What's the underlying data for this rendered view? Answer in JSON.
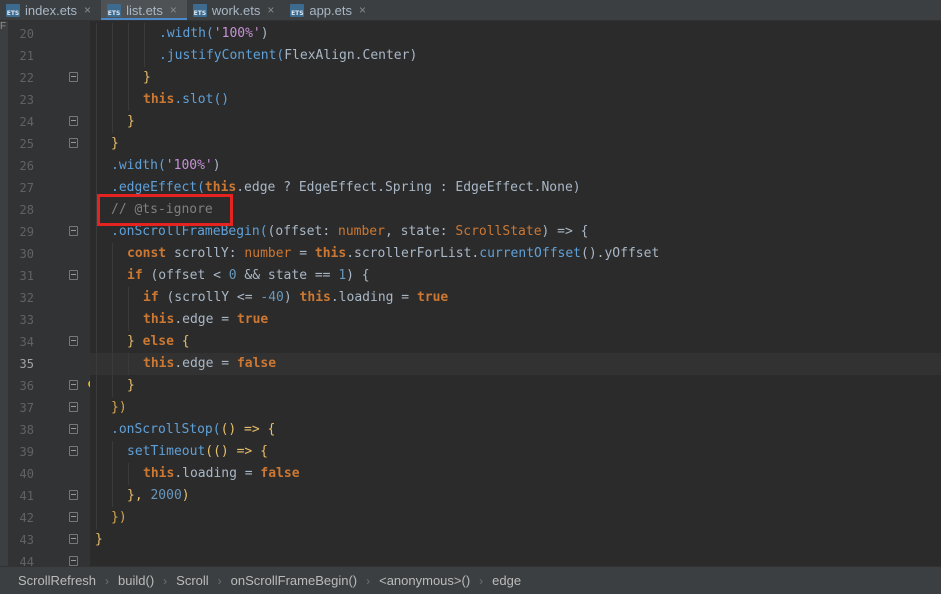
{
  "tabs": [
    {
      "label": "index.ets",
      "active": false
    },
    {
      "label": "list.ets",
      "active": true
    },
    {
      "label": "work.ets",
      "active": false
    },
    {
      "label": "app.ets",
      "active": false
    }
  ],
  "tab_close_glyph": "×",
  "leftstrip_mark": "F",
  "line_numbers": [
    "20",
    "21",
    "22",
    "23",
    "24",
    "25",
    "26",
    "27",
    "28",
    "29",
    "30",
    "31",
    "32",
    "33",
    "34",
    "35",
    "36",
    "37",
    "38",
    "39",
    "40",
    "41",
    "42",
    "43",
    "44"
  ],
  "current_line": "35",
  "code": {
    "l20_width": ".width(",
    "l20_str": "'100%'",
    "l20_close": ")",
    "l21_justify": ".justifyContent(",
    "l21_arg": "FlexAlign.Center",
    "l21_close": ")",
    "l22": "}",
    "l23_this": "this",
    "l23_slot": ".slot()",
    "l24": "}",
    "l25": "}",
    "l26_width": ".width(",
    "l26_str": "'100%'",
    "l26_close": ")",
    "l27_edge": ".edgeEffect(",
    "l27_this": "this",
    "l27_rest": ".edge ? EdgeEffect.Spring : EdgeEffect.None)",
    "l28_comment": "// @ts-ignore",
    "l29_method": ".onScrollFrameBegin(",
    "l29_params_a": "(offset: ",
    "l29_type1": "number",
    "l29_params_b": ", state: ",
    "l29_type2": "ScrollState",
    "l29_params_c": ") => {",
    "l30_const": "const",
    "l30_name": " scrollY: ",
    "l30_type": "number",
    "l30_eq": " = ",
    "l30_this": "this",
    "l30_rest_a": ".scrollerForList.",
    "l30_call": "currentOffset",
    "l30_rest_b": "().yOffset",
    "l31_if": "if",
    "l31_a": " (offset < ",
    "l31_n0": "0",
    "l31_b": " && state == ",
    "l31_n1": "1",
    "l31_c": ") {",
    "l32_if": "if",
    "l32_a": " (scrollY <= ",
    "l32_n": "-40",
    "l32_b": ") ",
    "l32_this": "this",
    "l32_c": ".loading = ",
    "l32_true": "true",
    "l33_this": "this",
    "l33_a": ".edge = ",
    "l33_true": "true",
    "l34_a": "} ",
    "l34_else": "else",
    "l34_b": " {",
    "l35_this": "this",
    "l35_a": ".edge = ",
    "l35_false": "false",
    "l36": "}",
    "l37": "})",
    "l38_method": ".onScrollStop(",
    "l38_a": "() => {",
    "l39_call": "setTimeout",
    "l39_a": "(() => {",
    "l40_this": "this",
    "l40_a": ".loading = ",
    "l40_false": "false",
    "l41_a": "}, ",
    "l41_n": "2000",
    "l41_b": ")",
    "l42": "})",
    "l43": "}",
    "l44": "}"
  },
  "breadcrumbs": [
    "ScrollRefresh",
    "build()",
    "Scroll",
    "onScrollFrameBegin()",
    "<anonymous>()",
    "edge"
  ],
  "breadcrumb_sep": "›",
  "colors": {
    "highlight_box": "#e52421",
    "keyword": "#cc7832",
    "string": "#c791d6",
    "number": "#6897bb",
    "comment": "#808080",
    "method": "#ffc66d"
  }
}
